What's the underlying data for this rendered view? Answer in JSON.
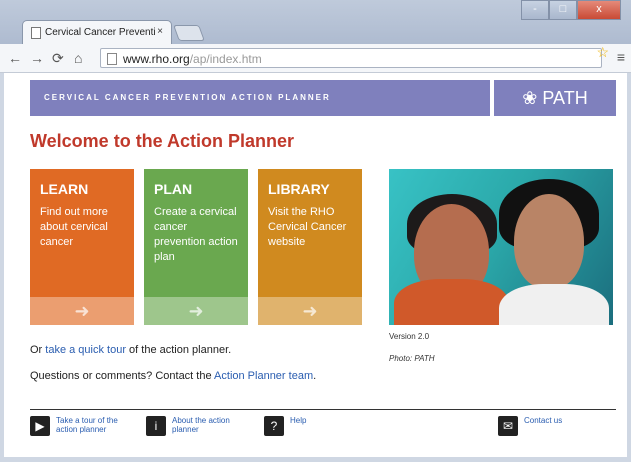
{
  "browser": {
    "tab_title": "Cervical Cancer Preventio",
    "tab_close": "×",
    "url_host": "www.rho.org",
    "url_path": "/ap/index.htm",
    "window_buttons": [
      "-",
      "□",
      "x"
    ]
  },
  "header": {
    "banner": "CERVICAL CANCER PREVENTION ACTION PLANNER",
    "logo": "PATH"
  },
  "main": {
    "title": "Welcome to the Action Planner",
    "cards": [
      {
        "title": "LEARN",
        "desc": "Find out more about cervical cancer",
        "color": "#e06a24"
      },
      {
        "title": "PLAN",
        "desc": "Create a cervical cancer prevention action plan",
        "color": "#6aa84f"
      },
      {
        "title": "LIBRARY",
        "desc": "Visit the RHO Cervical Cancer website",
        "color": "#d08a1f"
      }
    ],
    "tour_prefix": "Or ",
    "tour_link": "take a quick tour",
    "tour_suffix": " of the action planner.",
    "contact_prefix": "Questions or comments? Contact the ",
    "contact_link": "Action Planner team",
    "contact_suffix": ".",
    "version": "Version 2.0",
    "credit": "Photo: PATH"
  },
  "footer": [
    {
      "label": "Take a tour of the action planner",
      "icon": "video-camera-icon"
    },
    {
      "label": "About the action planner",
      "icon": "info-icon"
    },
    {
      "label": "Help",
      "icon": "help-icon"
    },
    {
      "label": "Contact us",
      "icon": "mail-icon"
    }
  ]
}
